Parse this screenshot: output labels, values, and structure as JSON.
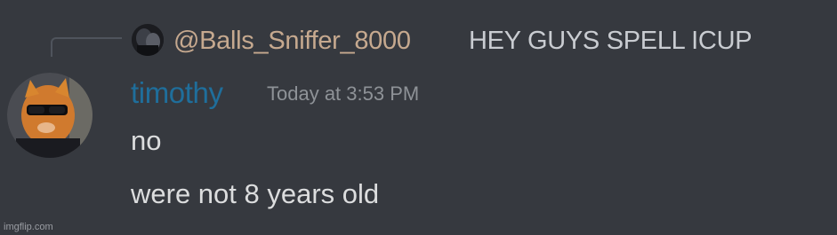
{
  "reply": {
    "author": "@Balls_Sniffer_8000",
    "text": "HEY GUYS SPELL ICUP"
  },
  "message": {
    "username": "timothy",
    "timestamp": "Today at 3:53 PM",
    "lines": [
      "no",
      "were not 8 years old"
    ]
  },
  "watermark": "imgflip.com",
  "colors": {
    "background": "#36393f",
    "username": "#1f6e9b",
    "reply_author": "#c6a98f",
    "timestamp": "#8e9297",
    "message_text": "#dcddde"
  }
}
